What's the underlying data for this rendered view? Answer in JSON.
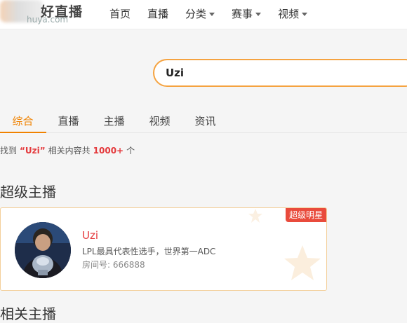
{
  "header": {
    "logo_text": "好直播",
    "logo_sub": "huya.com",
    "nav": [
      {
        "label": "首页"
      },
      {
        "label": "直播"
      },
      {
        "label": "分类"
      },
      {
        "label": "赛事"
      },
      {
        "label": "视频"
      }
    ]
  },
  "search": {
    "value": "Uzi"
  },
  "tabs": [
    {
      "label": "综合"
    },
    {
      "label": "直播"
    },
    {
      "label": "主播"
    },
    {
      "label": "视频"
    },
    {
      "label": "资讯"
    }
  ],
  "result": {
    "prefix": "找到",
    "keyword": "“Uzi”",
    "middle": "相关内容共",
    "count": "1000+",
    "suffix": "个"
  },
  "sections": {
    "super": "超级主播",
    "related": "相关主播"
  },
  "anchor_card": {
    "badge": "超级明星",
    "name": "Uzi",
    "desc": "LPL最具代表性选手，世界第一ADC",
    "room": "房间号: 666888"
  },
  "colors": {
    "accent": "#f08200",
    "search_border": "#f5a340",
    "highlight": "#e4393c"
  }
}
